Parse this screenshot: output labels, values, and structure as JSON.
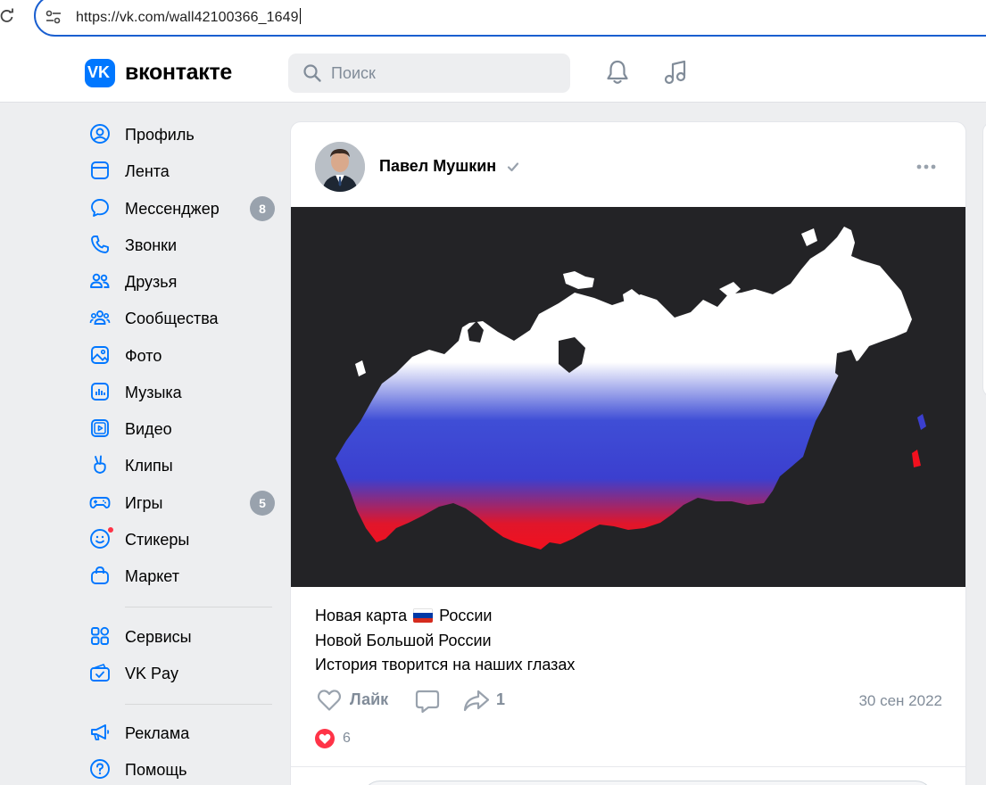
{
  "browser": {
    "url": "https://vk.com/wall42100366_1649"
  },
  "header": {
    "logo_text": "VK",
    "brand": "вконтакте",
    "search_placeholder": "Поиск"
  },
  "sidebar": {
    "items": [
      {
        "label": "Профиль",
        "icon": "profile-icon"
      },
      {
        "label": "Лента",
        "icon": "feed-icon"
      },
      {
        "label": "Мессенджер",
        "icon": "messenger-icon",
        "badge": "8"
      },
      {
        "label": "Звонки",
        "icon": "phone-icon"
      },
      {
        "label": "Друзья",
        "icon": "friends-icon"
      },
      {
        "label": "Сообщества",
        "icon": "communities-icon"
      },
      {
        "label": "Фото",
        "icon": "photo-icon"
      },
      {
        "label": "Музыка",
        "icon": "music-note-icon"
      },
      {
        "label": "Видео",
        "icon": "video-icon"
      },
      {
        "label": "Клипы",
        "icon": "clips-icon"
      },
      {
        "label": "Игры",
        "icon": "games-icon",
        "badge": "5"
      },
      {
        "label": "Стикеры",
        "icon": "stickers-icon"
      },
      {
        "label": "Маркет",
        "icon": "market-icon"
      },
      {
        "label": "Сервисы",
        "icon": "services-icon"
      },
      {
        "label": "VK Pay",
        "icon": "vkpay-icon"
      },
      {
        "label": "Реклама",
        "icon": "megaphone-icon"
      },
      {
        "label": "Помощь",
        "icon": "help-icon"
      }
    ]
  },
  "post": {
    "author": "Павел Мушкин",
    "text_lines": [
      {
        "before": "Новая карта",
        "after": "России"
      },
      {
        "text": "Новой Большой России"
      },
      {
        "text": "История творится на наших глазах"
      }
    ],
    "like_label": "Лайк",
    "share_count": "1",
    "date": "30 сен 2022",
    "reactions_count": "6"
  },
  "colors": {
    "accent": "#0077ff",
    "badge": "#99a2ad",
    "heart": "#ff3347",
    "muted_text": "#818c99",
    "page_bg": "#edeef0"
  }
}
